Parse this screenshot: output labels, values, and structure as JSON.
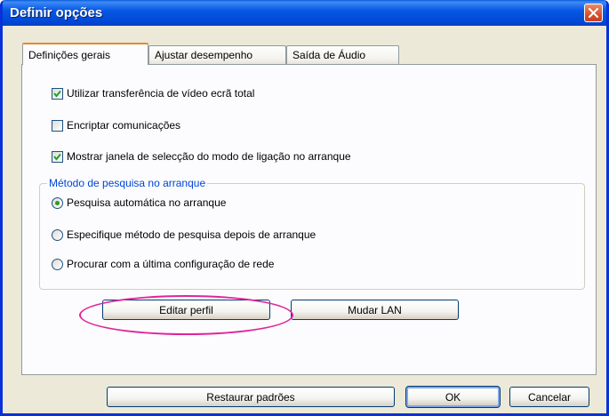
{
  "window": {
    "title": "Definir opções"
  },
  "tabs": [
    {
      "label": "Definições gerais",
      "active": true
    },
    {
      "label": "Ajustar desempenho",
      "active": false
    },
    {
      "label": "Saída de Áudio",
      "active": false
    }
  ],
  "options": {
    "full_screen_video": {
      "label": "Utilizar transferência de vídeo ecrã total",
      "checked": true
    },
    "encrypt": {
      "label": "Encriptar comunicações",
      "checked": false
    },
    "show_mode_window": {
      "label": "Mostrar janela de selecção do modo de ligação no arranque",
      "checked": true
    }
  },
  "search_method": {
    "legend": "Método de pesquisa no arranque",
    "selected_index": 0,
    "options": [
      "Pesquisa automática no arranque",
      "Especifique método de pesquisa depois de arranque",
      "Procurar com a última configuração de rede"
    ]
  },
  "buttons": {
    "edit_profile": "Editar perfil",
    "change_lan": "Mudar LAN",
    "restore_defaults": "Restaurar padrões",
    "ok": "OK",
    "cancel": "Cancelar"
  },
  "colors": {
    "title_bar": "#0058e6",
    "highlight_ellipse": "#e0259a",
    "group_legend": "#0046d5"
  }
}
